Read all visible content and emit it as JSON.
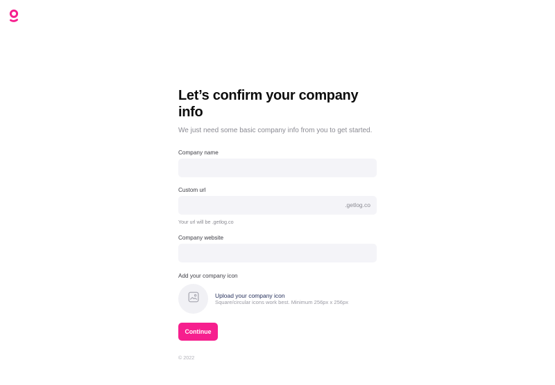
{
  "brand": {
    "accent": "#f61f8e",
    "logo_icon": "getlog-logo-icon"
  },
  "header": {
    "title": "Let’s confirm your company info",
    "subtitle": "We just need some basic company info from you to get started."
  },
  "form": {
    "company_name": {
      "label": "Company name",
      "value": ""
    },
    "custom_url": {
      "label": "Custom url",
      "value": "",
      "suffix": ".getlog.co",
      "hint": "Your url will be .getlog.co"
    },
    "company_website": {
      "label": "Company website",
      "value": ""
    },
    "company_icon": {
      "label": "Add your company icon",
      "upload_icon": "image-placeholder-icon",
      "upload_title": "Upload your company icon",
      "upload_subtitle": "Square/circular icons work best. Minimum 256px x 256px"
    },
    "continue_label": "Continue"
  },
  "footer": {
    "copyright": "© 2022"
  }
}
